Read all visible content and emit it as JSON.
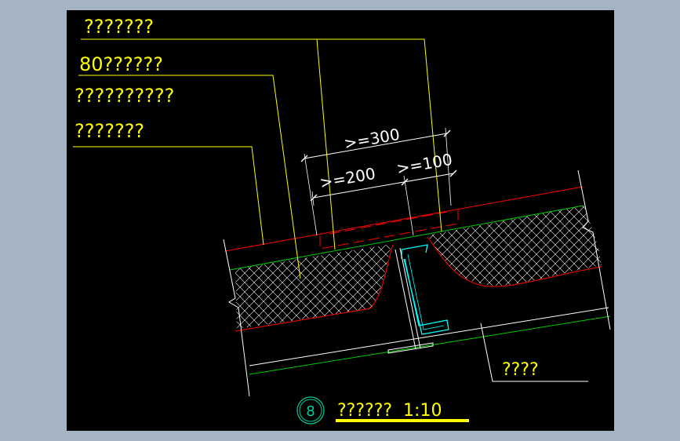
{
  "colors": {
    "background": "#a4b4c4",
    "canvas": "#000000",
    "label": "#ffff00",
    "dimension": "#ffffff",
    "membrane": "#ff0000",
    "insulation_edge": "#00cc00",
    "purlin": "#00ffff"
  },
  "callouts": [
    {
      "text": "???????"
    },
    {
      "text": "80??????"
    },
    {
      "text": "??????????"
    },
    {
      "text": "???????"
    }
  ],
  "dimensions": {
    "overall": ">=300",
    "left": ">=200",
    "right": ">=100"
  },
  "side_label": "????",
  "detail": {
    "number": "8",
    "title": "??????  1:10"
  }
}
